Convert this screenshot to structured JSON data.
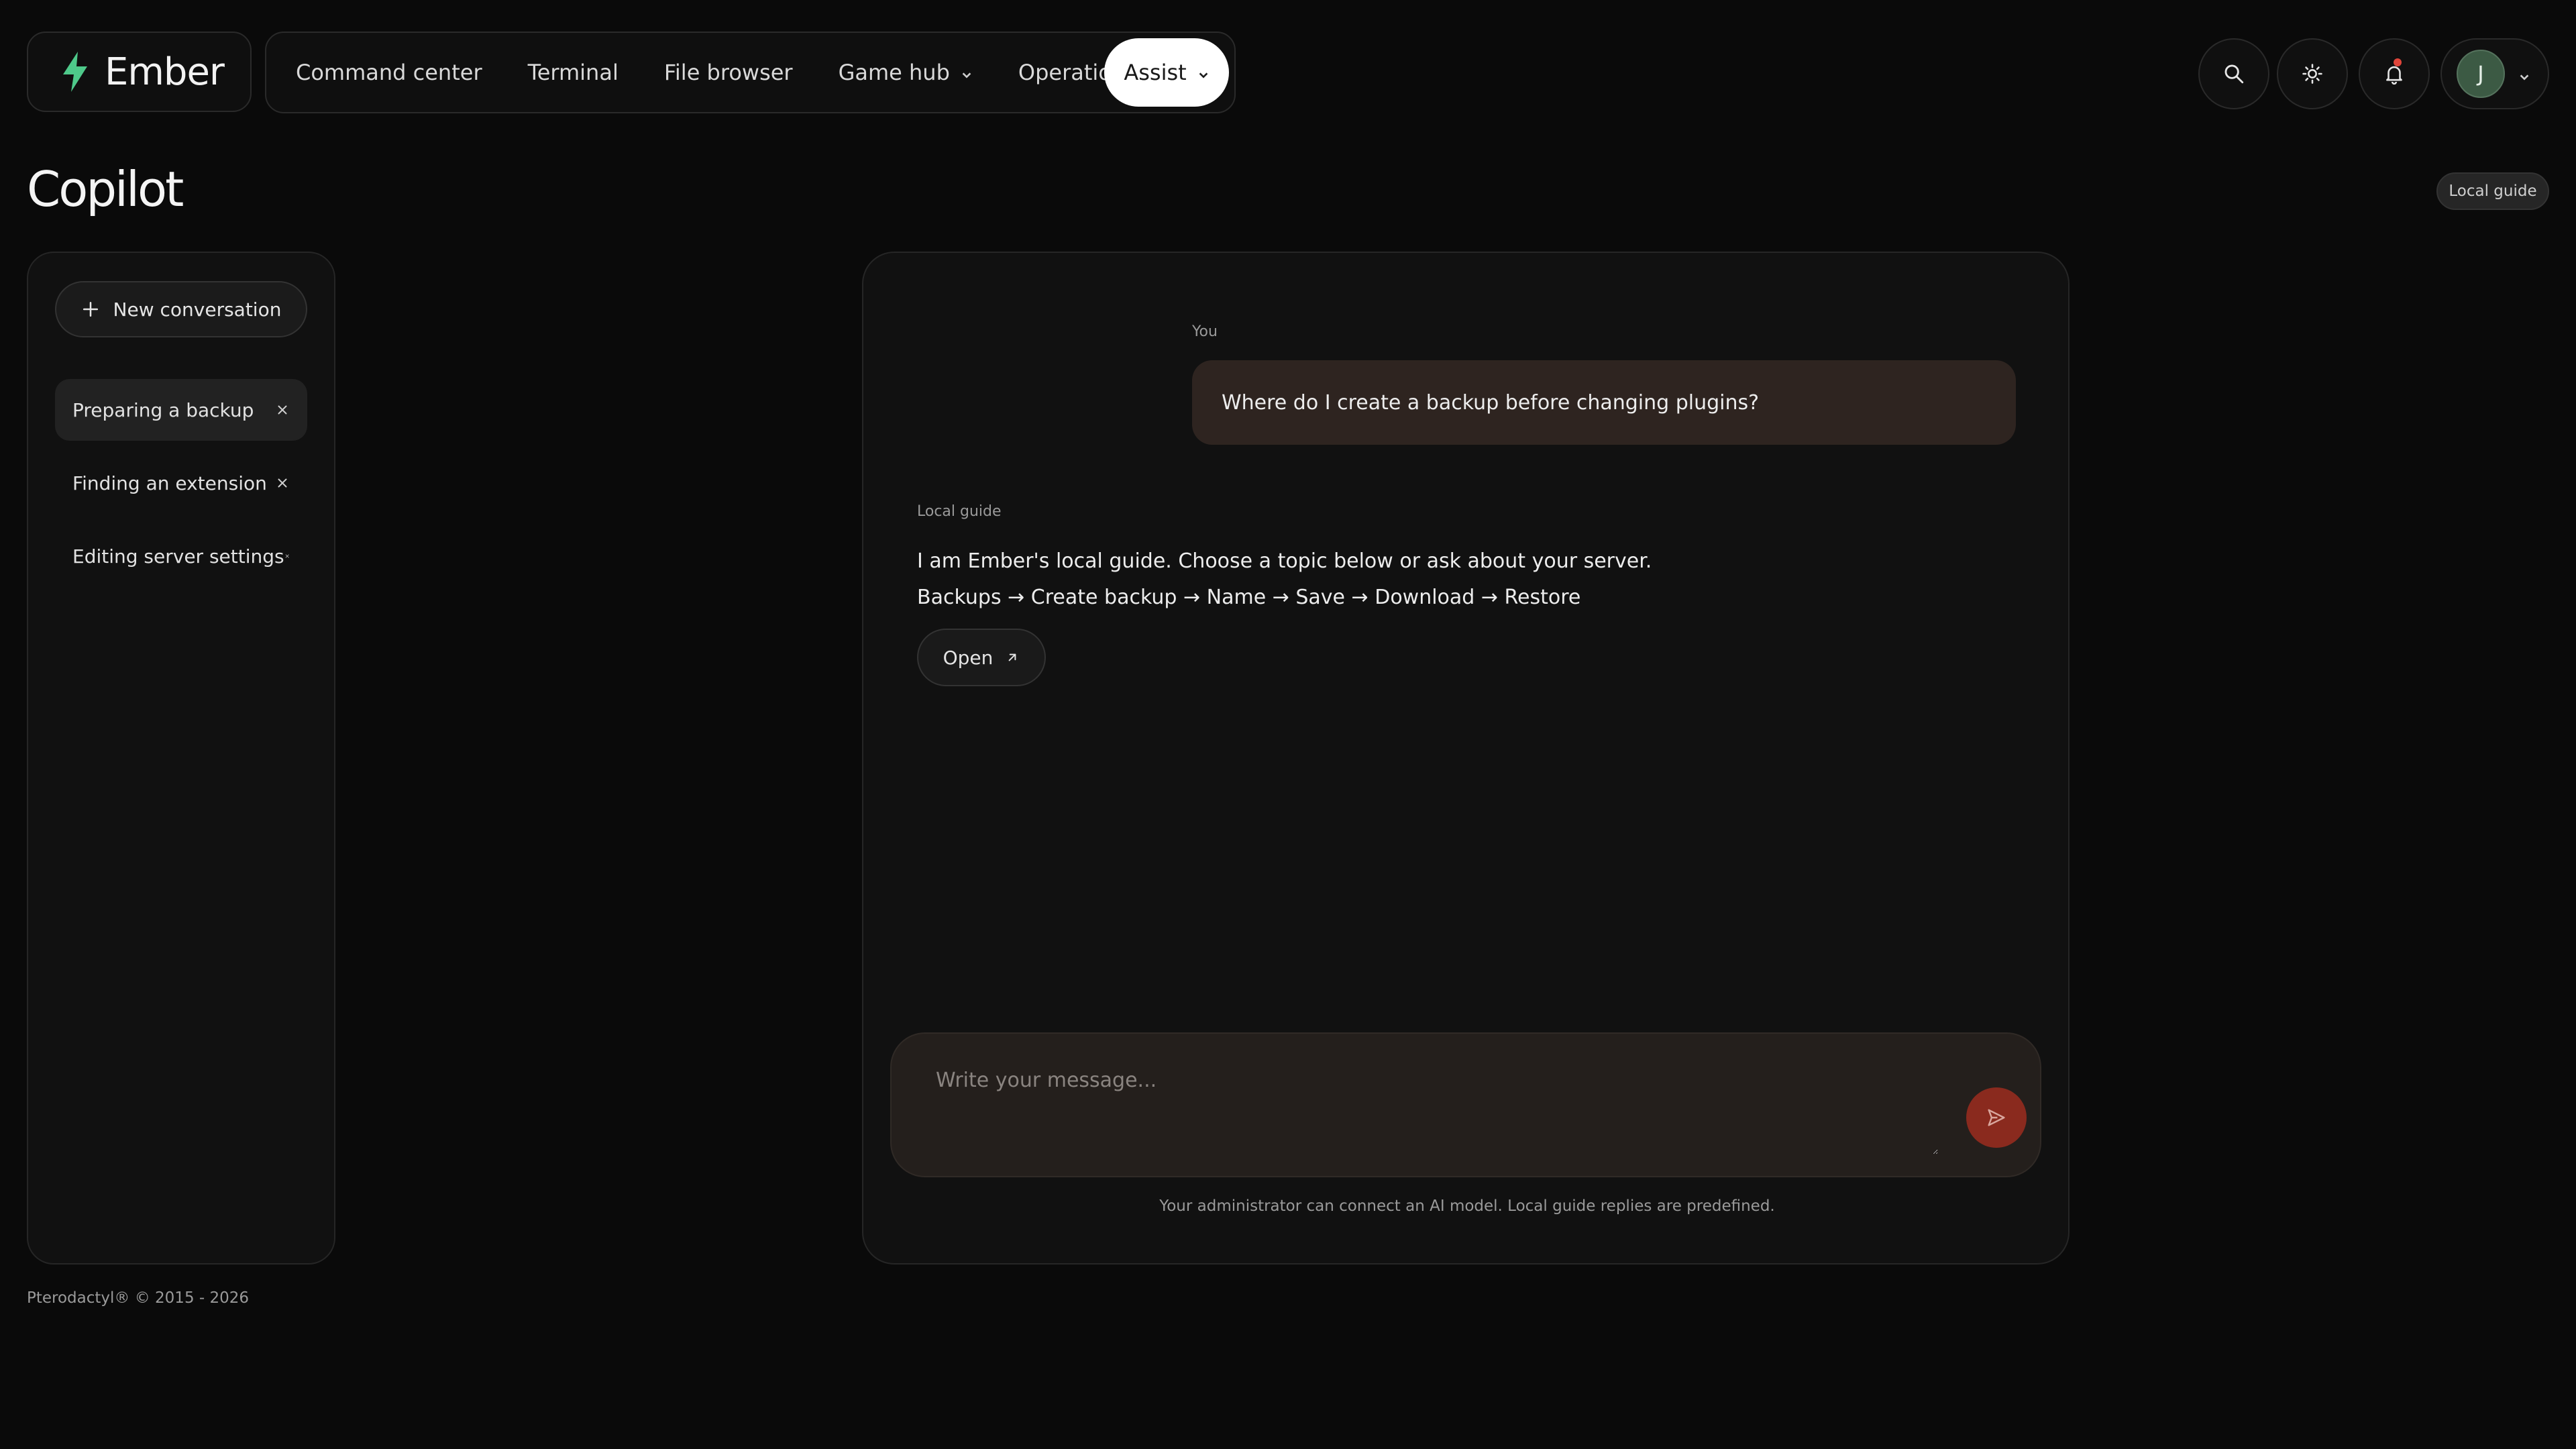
{
  "brand": {
    "name": "Ember"
  },
  "nav": {
    "items": [
      {
        "label": "Command center",
        "has_dropdown": false
      },
      {
        "label": "Terminal",
        "has_dropdown": false
      },
      {
        "label": "File browser",
        "has_dropdown": false
      },
      {
        "label": "Game hub",
        "has_dropdown": true
      },
      {
        "label": "Operations",
        "has_dropdown": true
      },
      {
        "label": "Assist",
        "has_dropdown": true,
        "active": true
      }
    ]
  },
  "header_actions": {
    "search_icon": "search-icon",
    "theme_icon": "sun-icon",
    "notifications_icon": "bell-icon",
    "has_unread": true,
    "avatar_initial": "J"
  },
  "page": {
    "title": "Copilot",
    "mode_badge": "Local guide"
  },
  "sidebar": {
    "new_conversation_label": "New conversation",
    "conversations": [
      {
        "label": "Preparing a backup",
        "selected": true
      },
      {
        "label": "Finding an extension",
        "selected": false
      },
      {
        "label": "Editing server settings",
        "selected": false
      }
    ]
  },
  "chat": {
    "user_label": "You",
    "user_message": "Where do I create a backup before changing plugins?",
    "guide_label": "Local guide",
    "guide_message": "I am Ember's local guide. Choose a topic below or ask about your server.",
    "guide_steps": "Backups → Create backup → Name → Save → Download → Restore",
    "open_label": "Open",
    "composer_placeholder": "Write your message...",
    "composer_value": "",
    "disclaimer": "Your administrator can connect an AI model. Local guide replies are predefined."
  },
  "footer": {
    "text": "Pterodactyl® © 2015 - 2026"
  },
  "colors": {
    "background": "#0a0a0a",
    "panel": "#111111",
    "accent_send": "#8a2a1e",
    "user_bubble": "#2e2420",
    "brand_bolt": "#4ec98a",
    "notification_dot": "#e0453a"
  }
}
